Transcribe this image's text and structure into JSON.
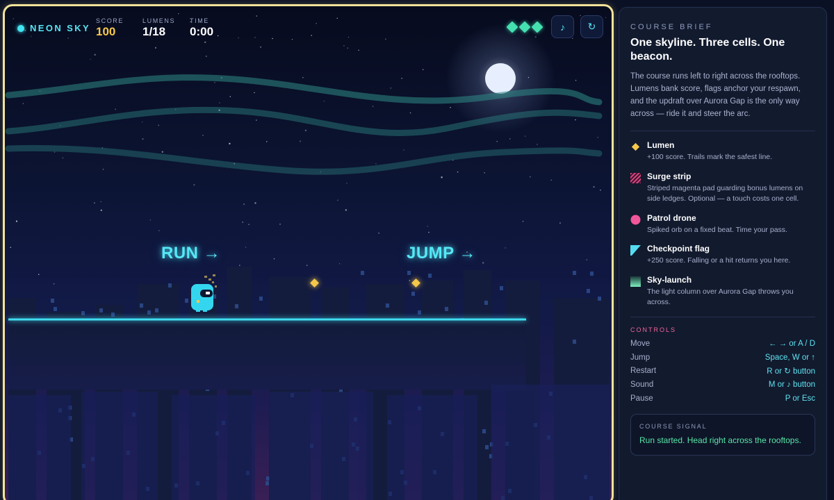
{
  "hud": {
    "brand": "NEON SKY",
    "score_label": "SCORE",
    "score_value": "100",
    "lumens_label": "LUMENS",
    "lumens_value": "1/18",
    "time_label": "TIME",
    "time_value": "0:00",
    "cells_remaining": 3,
    "cells_total": 3,
    "sound_icon": "music-note-icon",
    "restart_icon": "restart-icon"
  },
  "scene": {
    "coach_run": "RUN →",
    "coach_jump": "JUMP →"
  },
  "panel": {
    "kicker": "COURSE BRIEF",
    "title": "One skyline. Three cells. One beacon.",
    "body": "The course runs left to right across the rooftops. Lumens bank score, flags anchor your respawn, and the updraft over Aurora Gap is the only way across — ride it and steer the arc.",
    "legend": [
      {
        "name": "Lumen",
        "desc": "+100 score. Trails mark the safest line.",
        "icon": "lumen-icon"
      },
      {
        "name": "Surge strip",
        "desc": "Striped magenta pad guarding bonus lumens on side ledges. Optional — a touch costs one cell.",
        "icon": "surge-strip-icon"
      },
      {
        "name": "Patrol drone",
        "desc": "Spiked orb on a fixed beat. Time your pass.",
        "icon": "patrol-drone-icon"
      },
      {
        "name": "Checkpoint flag",
        "desc": "+250 score. Falling or a hit returns you here.",
        "icon": "checkpoint-flag-icon"
      },
      {
        "name": "Sky-launch",
        "desc": "The light column over Aurora Gap throws you across.",
        "icon": "sky-launch-icon"
      }
    ],
    "controls_title": "CONTROLS",
    "controls": [
      {
        "action": "Move",
        "keys": "← → or A / D"
      },
      {
        "action": "Jump",
        "keys": "Space, W or ↑"
      },
      {
        "action": "Restart",
        "keys": "R or ↻ button"
      },
      {
        "action": "Sound",
        "keys": "M or ♪ button"
      },
      {
        "action": "Pause",
        "keys": "P or Esc"
      }
    ],
    "signal_title": "COURSE SIGNAL",
    "signal_text": "Run started. Head right across the rooftops."
  },
  "colors": {
    "frame": "#f4e39a",
    "neon_cyan": "#55e8f6",
    "score_gold": "#f5c84a",
    "cell_green": "#45e0b0",
    "controls_pink": "#f0679a",
    "signal_green": "#58e6a8"
  }
}
